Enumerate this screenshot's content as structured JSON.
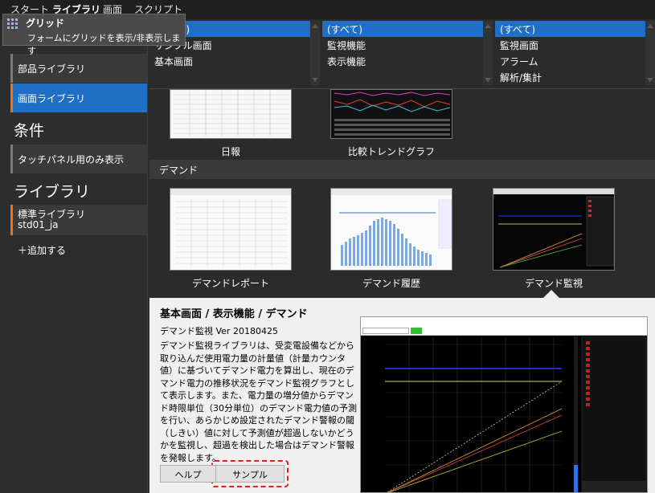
{
  "menubar": {
    "items": [
      "スタート",
      "ライブラリ",
      "画面",
      "スクリプト"
    ],
    "active_index": 1
  },
  "tooltip": {
    "title": "グリッド",
    "description": "フォームにグリッドを表示/非表示します",
    "icon": "grid-icon"
  },
  "sidebar": {
    "heading_category_visible": "種",
    "items_top": [
      "部品ライブラリ",
      "画面ライブラリ"
    ],
    "selected_item": "画面ライブラリ",
    "heading_condition": "条件",
    "condition_item": "タッチパネル用のみ表示",
    "heading_library": "ライブラリ",
    "library_name": "標準ライブラリ",
    "library_id": "std01_ja",
    "add_label": "＋追加する"
  },
  "filters": {
    "list1": [
      "(すべて)",
      "サンプル画面",
      "基本画面"
    ],
    "list2": [
      "(すべて)",
      "監視機能",
      "表示機能"
    ],
    "list3": [
      "(すべて)",
      "監視画面",
      "アラーム",
      "解析/集計"
    ]
  },
  "content": {
    "top_thumbs": [
      "日報",
      "比較トレンドグラフ"
    ],
    "section": "デマンド",
    "demand_thumbs": [
      "デマンドレポート",
      "デマンド履歴",
      "デマンド監視"
    ]
  },
  "detail": {
    "title": "基本画面 / 表示機能 / デマンド",
    "subtitle": "デマンド監視  Ver 20180425",
    "description": "デマンド監視ライブラリは、受変電設備などから取り込んだ使用電力量の計量値（計量カウンタ値）に基づいてデマンド電力を算出し、現在のデマンド電力の推移状況をデマンド監視グラフとして表示します。また、電力量の増分値からデマンド時限単位（30分単位）のデマンド電力値の予測を行い、あらかじめ設定されたデマンド警報の閾（しきい）値に対して予測値が超過しないかどうかを監視し、超過を検出した場合はデマンド警報を発報します。",
    "help_button": "ヘルプ",
    "sample_button": "サンプル"
  },
  "colors": {
    "accent": "#1f6fc6",
    "highlight": "#e8761d",
    "dashed_outline": "#e02020"
  }
}
